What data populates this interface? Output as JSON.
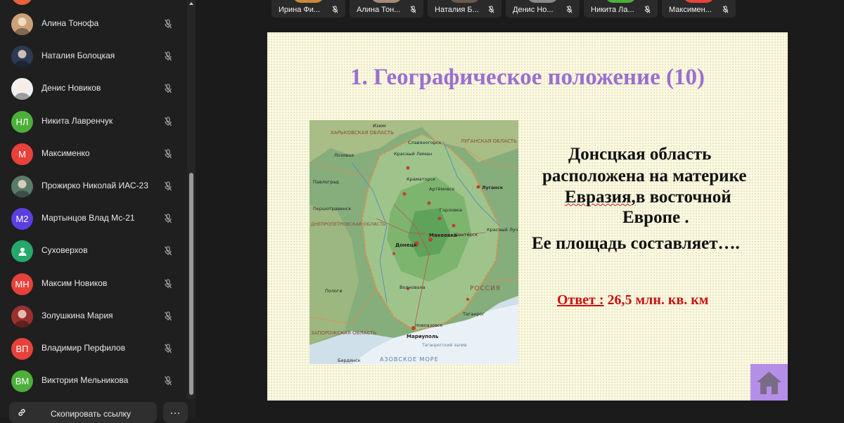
{
  "participants": [
    {
      "name": "Алина Тонофа",
      "avatar_type": "photo",
      "avatar_color": "#c9a27a"
    },
    {
      "name": "Наталия Болоцкая",
      "avatar_type": "photo",
      "avatar_color": "#2c3a52"
    },
    {
      "name": "Денис Новиков",
      "avatar_type": "photo",
      "avatar_color": "#f0f0f0"
    },
    {
      "name": "Никита Лавренчук",
      "initials": "НЛ",
      "avatar_color": "#4caf3a"
    },
    {
      "name": "Максименко",
      "initials": "М",
      "avatar_color": "#e8413b"
    },
    {
      "name": "Прожирко Николай ИАС-23",
      "avatar_type": "photo",
      "avatar_color": "#5a7a6a"
    },
    {
      "name": "Мартынцов Влад Мс-21",
      "initials": "М2",
      "avatar_color": "#5b3fe0"
    },
    {
      "name": "Суховерхов",
      "avatar_type": "user-icon",
      "avatar_color": "#27a86b"
    },
    {
      "name": "Максим Новиков",
      "initials": "МН",
      "avatar_color": "#e8413b"
    },
    {
      "name": "Золушкина Мария",
      "avatar_type": "photo",
      "avatar_color": "#9a3030"
    },
    {
      "name": "Владимир Перфилов",
      "initials": "ВП",
      "avatar_color": "#e8413b"
    },
    {
      "name": "Виктория Мельникова",
      "initials": "ВМ",
      "avatar_color": "#4caf3a"
    }
  ],
  "copy_link_label": "Скопировать ссылку",
  "more_label": "…",
  "video_tiles": [
    {
      "name": "Ирина Фи...",
      "thumb_color": "#c98a3a"
    },
    {
      "name": "Алина Тон...",
      "thumb_color": "#a88a78"
    },
    {
      "name": "Наталия Б...",
      "thumb_color": "#6b5a4a"
    },
    {
      "name": "Денис Но...",
      "thumb_color": "#8a8a8a"
    },
    {
      "name": "Никита Ла...",
      "thumb_color": "#4caf3a"
    },
    {
      "name": "Максимен...",
      "thumb_color": "#e8413b"
    }
  ],
  "slide": {
    "title": "1. Географическое положение  (10)",
    "line1": "Донсцкая область",
    "line2": "расположена на материке",
    "line3_underlined": "Евразия,",
    "line3_rest": "в восточной",
    "line4": "Европе .",
    "line5": "Ее площадь составляет….",
    "answer_label": "Ответ :",
    "answer_value": " 26,5 млн. кв. км"
  },
  "map": {
    "labels": {
      "kharkiv": "ХАРЬКОВСКАЯ ОБЛАСТЬ",
      "luhansk": "ЛУГАНСКАЯ ОБЛАСТЬ",
      "dnipro": "ДНЕПРОПЕТРОВСКАЯ ОБЛАСТЬ",
      "zaporizhzhia": "ЗАПОРОЖСКАЯ ОБЛАСТЬ",
      "russia": "РОССИЯ",
      "sea": "АЗОВСКОЕ МОРЕ",
      "gulf": "Таганрогский залив",
      "donetsk": "Донецк",
      "makeevka": "Макеевка",
      "mariupol": "Мариуполь",
      "izyum": "Изюм",
      "slavyansk": "Славяногорск",
      "kramatorsk": "Краматорск",
      "artemovsk": "Артёмовск",
      "gorlovka": "Горловка",
      "shakhtersk": "Шахтёрск",
      "volnovakha": "Волноваха",
      "novoazovsk": "Новоазовск",
      "taganrog": "Таганрог",
      "lugansk_city": "Луганск",
      "krasny_luch": "Красный Луч",
      "polog": "Пологи",
      "berdyansk": "Бердянск",
      "krasny_liman": "Красный Лиман",
      "lozovaya": "Лозовая",
      "pershotravensk": "Першотравенск",
      "pavlograd": "Павлоград"
    }
  }
}
